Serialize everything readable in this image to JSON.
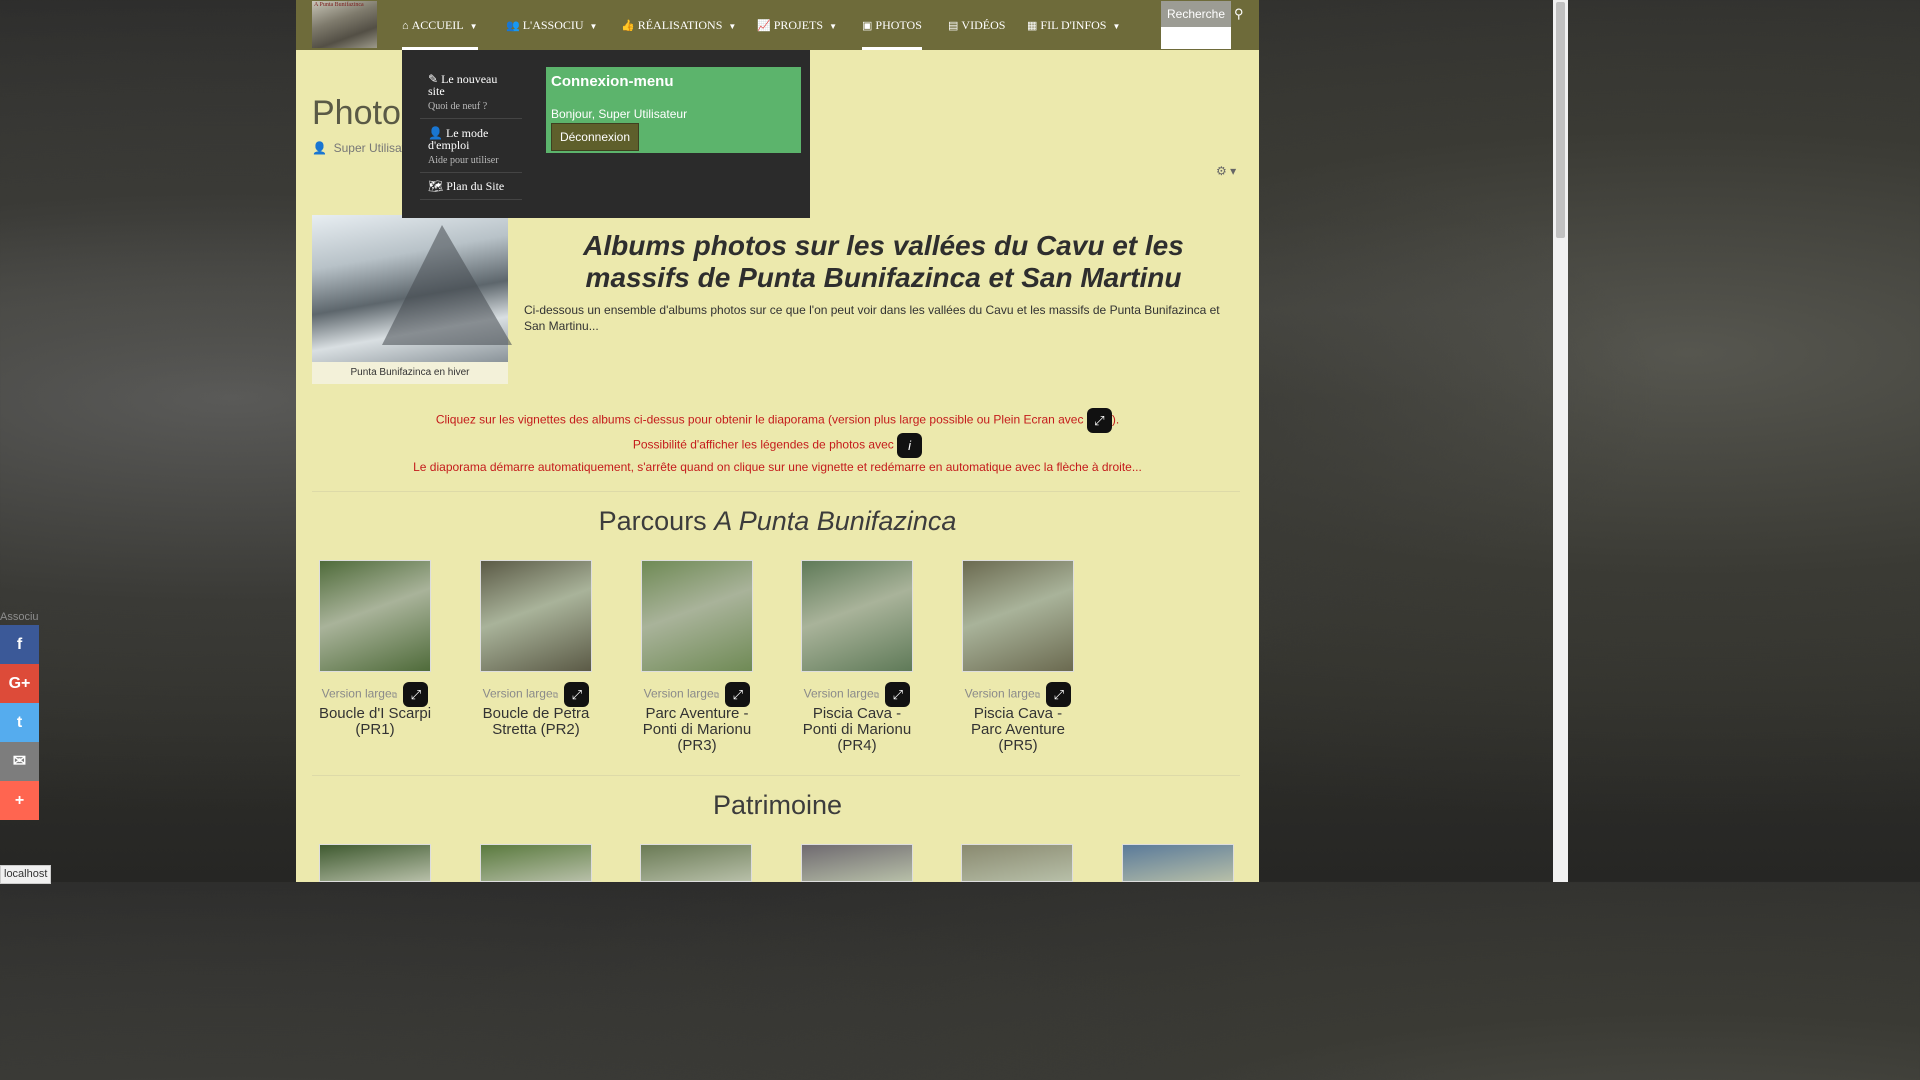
{
  "nav": {
    "logo_text": "A Punta Bunifazinca",
    "items": [
      {
        "label": "ACCUEIL",
        "icon": "home-icon"
      },
      {
        "label": "L'ASSOCIU",
        "icon": "users-icon"
      },
      {
        "label": "RÉALISATIONS",
        "icon": "thumbs-up-icon"
      },
      {
        "label": "PROJETS",
        "icon": "line-chart-icon"
      },
      {
        "label": "PHOTOS",
        "icon": "image-icon"
      },
      {
        "label": "VIDÉOS",
        "icon": "film-icon"
      },
      {
        "label": "FIL D'INFOS",
        "icon": "newspaper-icon"
      }
    ],
    "search_placeholder": "Recherche"
  },
  "page": {
    "title": "Photo",
    "author": "Super Utilisate"
  },
  "dropdown": {
    "items": [
      {
        "label": "Le nouveau site",
        "sub": "Quoi de neuf ?"
      },
      {
        "label": "Le mode d'emploi",
        "sub": "Aide pour utiliser"
      },
      {
        "label": "Plan du Site",
        "sub": ""
      }
    ],
    "login": {
      "title": "Connexion-menu",
      "greeting": "Bonjour, Super Utilisateur",
      "logout": "Déconnexion"
    }
  },
  "hero": {
    "caption": "Punta Bunifazinca en hiver",
    "title": "Albums photos sur les vallées du Cavu et les massifs de Punta Bunifazinca et San Martinu",
    "desc": "Ci-dessous un ensemble d'albums photos sur ce que l'on peut voir dans les vallées du Cavu et les massifs de Punta Bunifazinca et San Martinu..."
  },
  "notes": {
    "line1_before": "Cliquez sur les vignettes des albums ci-dessus pour obtenir le diaporama (version plus large possible ou Plein Ecran avec",
    "line1_after": ").",
    "line2": "Possibilité d'afficher les légendes de photos avec",
    "line3": "Le diaporama démarre automatiquement, s'arrête quand on clique sur une vignette et redémarre en automatique avec la flèche à droite..."
  },
  "sections": {
    "parcours_prefix": "Parcours",
    "parcours_italic": "A Punta Bunifazinca",
    "patrimoine": "Patrimoine"
  },
  "version_large": "Version large",
  "albums": [
    {
      "name": "Boucle d'I Scarpi (PR1)",
      "color": "#4f6b3a"
    },
    {
      "name": "Boucle de Petra Stretta (PR2)",
      "color": "#5b5a46"
    },
    {
      "name": "Parc Aventure - Ponti di Marionu (PR3)",
      "color": "#6f8a55"
    },
    {
      "name": "Piscia Cava - Ponti di Marionu (PR4)",
      "color": "#5f7a58"
    },
    {
      "name": "Piscia Cava - Parc Aventure (PR5)",
      "color": "#6b6a50"
    }
  ],
  "patrimoine_thumbs": [
    "#3f5a30",
    "#5a7a3e",
    "#6a7a55",
    "#6f6a70",
    "#8a8a70",
    "#5a7a9a"
  ],
  "share": {
    "label": "Associu",
    "buttons": [
      {
        "icon": "facebook-icon",
        "glyph": "f",
        "color": "#3b5998"
      },
      {
        "icon": "google-plus-icon",
        "glyph": "G+",
        "color": "#dd4b39"
      },
      {
        "icon": "twitter-icon",
        "glyph": "t",
        "color": "#55acee"
      },
      {
        "icon": "email-icon",
        "glyph": "✉",
        "color": "#7d7d7d"
      },
      {
        "icon": "share-plus-icon",
        "glyph": "+",
        "color": "#ff6550"
      }
    ]
  },
  "status": "localhost"
}
